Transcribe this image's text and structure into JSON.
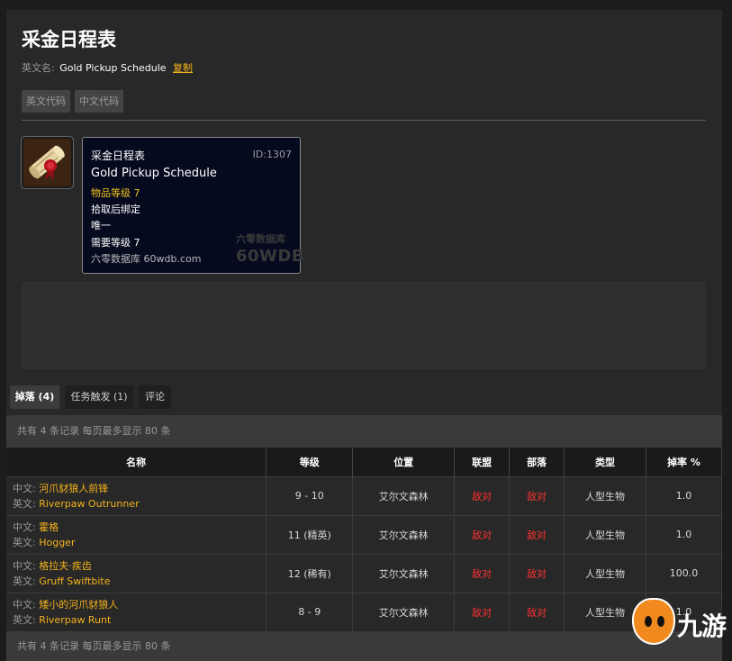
{
  "page": {
    "title": "采金日程表",
    "en_label": "英文名:",
    "en_name": "Gold Pickup Schedule",
    "copy_label": "复制",
    "code_en": "英文代码",
    "code_cn": "中文代码"
  },
  "tooltip": {
    "name_cn": "采金日程表",
    "id": "ID:1307",
    "name_en": "Gold Pickup Schedule",
    "item_level": "物品等级 7",
    "bind": "拾取后绑定",
    "unique": "唯一",
    "req_level": "需要等级 7",
    "site": "六零数据库 60wdb.com",
    "watermark_cn": "六零数据库",
    "watermark_en": "60WDB"
  },
  "tabs": [
    {
      "label": "掉落 (4)",
      "active": true
    },
    {
      "label": "任务触发 (1)",
      "active": false
    },
    {
      "label": "评论",
      "active": false
    }
  ],
  "summary": "共有 4 条记录 每页最多显示 80 条",
  "table": {
    "headers": [
      "名称",
      "等级",
      "位置",
      "联盟",
      "部落",
      "类型",
      "掉率 %"
    ],
    "cn_prefix": "中文:",
    "en_prefix": "英文:",
    "rows": [
      {
        "cn": "河爪豺狼人前锋",
        "en": "Riverpaw Outrunner",
        "level": "9 - 10",
        "location": "艾尔文森林",
        "alliance": "敌对",
        "horde": "敌对",
        "type": "人型生物",
        "rate": "1.0"
      },
      {
        "cn": "霍格",
        "en": "Hogger",
        "level": "11 (精英)",
        "location": "艾尔文森林",
        "alliance": "敌对",
        "horde": "敌对",
        "type": "人型生物",
        "rate": "1.0"
      },
      {
        "cn": "格拉夫·疾齿",
        "en": "Gruff Swiftbite",
        "level": "12 (稀有)",
        "location": "艾尔文森林",
        "alliance": "敌对",
        "horde": "敌对",
        "type": "人型生物",
        "rate": "100.0"
      },
      {
        "cn": "矮小的河爪豺狼人",
        "en": "Riverpaw Runt",
        "level": "8 - 9",
        "location": "艾尔文森林",
        "alliance": "敌对",
        "horde": "敌对",
        "type": "人型生物",
        "rate": "1.0"
      }
    ]
  },
  "logo_text": "九游",
  "colors": {
    "accent": "#f2b21c",
    "hostile": "#ff3030",
    "tooltip_bg": "#060a1f"
  }
}
